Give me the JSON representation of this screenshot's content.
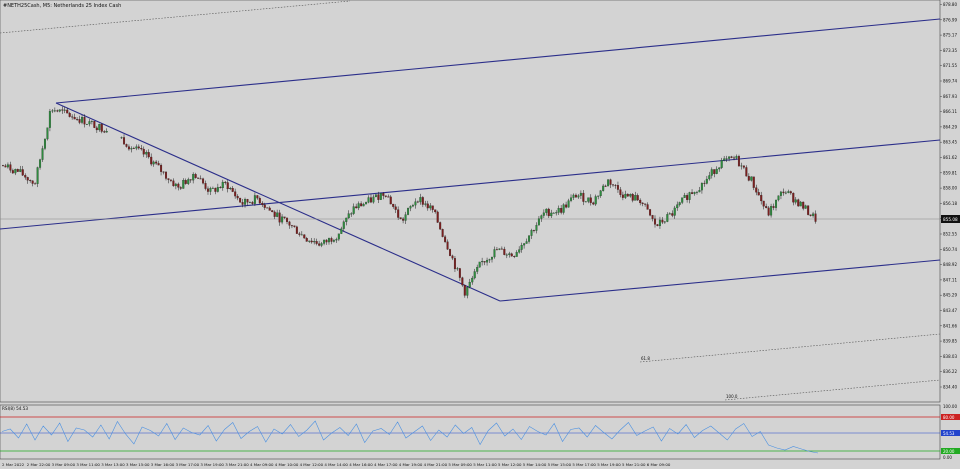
{
  "main_chart": {
    "symbol_label": "#NETH25Cash, M5: Netherlands 25 Index Cash",
    "price_axis": [
      "878.80",
      "876.99",
      "875.17",
      "873.35",
      "871.55",
      "869.74",
      "867.93",
      "866.11",
      "864.29",
      "863.45",
      "861.62",
      "859.81",
      "858.00",
      "856.18",
      "854.37",
      "852.55",
      "850.74",
      "848.92",
      "847.11",
      "845.29",
      "843.47",
      "841.66",
      "839.85",
      "838.03",
      "836.22",
      "834.40"
    ],
    "current_price": "855.08",
    "fib_labels": [
      "61.8",
      "100.0"
    ],
    "colors": {
      "background": "#d3d3d3",
      "channel": "#2b2e8a",
      "bull": "#2e8b3e",
      "bear": "#7a1f1f",
      "dotted": "#555555"
    }
  },
  "chart_data": [
    {
      "type": "candlestick",
      "title": "#NETH25Cash, M5: Netherlands 25 Index Cash",
      "timeframe": "M5",
      "ylim": [
        834.4,
        878.8
      ],
      "x_ticks": [
        "2 Mar 2022",
        "2 Mar 22:00",
        "3 Mar 09:00",
        "3 Mar 11:00",
        "3 Mar 13:00",
        "3 Mar 15:00",
        "3 Mar 16:00",
        "3 Mar 17:00",
        "3 Mar 19:00",
        "3 Mar 21:00",
        "4 Mar 09:00",
        "4 Mar 10:00",
        "4 Mar 12:00",
        "4 Mar 14:00",
        "4 Mar 16:00",
        "4 Mar 17:00",
        "4 Mar 19:00",
        "4 Mar 21:00",
        "5 Mar 09:00",
        "5 Mar 11:00",
        "5 Mar 12:00",
        "5 Mar 14:00",
        "5 Mar 15:00",
        "5 Mar 17:00",
        "5 Mar 19:00",
        "5 Mar 21:00",
        "6 Mar 09:00"
      ],
      "approx_close_path": [
        860.5,
        859.8,
        858.5,
        866.8,
        866.2,
        865.5,
        864.8,
        864.2,
        862.6,
        861.6,
        859.8,
        858.0,
        859.7,
        857.6,
        858.5,
        856.3,
        856.9,
        855.1,
        854.0,
        852.5,
        851.8,
        852.9,
        855.8,
        856.6,
        857.6,
        854.3,
        857.0,
        855.5,
        851.2,
        846.5,
        849.7,
        851.2,
        850.6,
        852.8,
        855.3,
        855.6,
        857.3,
        856.5,
        858.9,
        857.2,
        856.7,
        853.8,
        855.2,
        857.3,
        858.6,
        860.8,
        861.3,
        858.8,
        855.1,
        857.8,
        856.3,
        854.6
      ],
      "current_price": 855.08,
      "fibonacci_levels": [
        "61.8",
        "100.0"
      ]
    },
    {
      "type": "line",
      "title": "RSI(8) 54.53",
      "indicator": "RSI",
      "period": 8,
      "value": 54.53,
      "ylim": [
        0,
        100
      ],
      "levels": [
        20,
        80
      ],
      "values": [
        55,
        60,
        42,
        70,
        38,
        66,
        48,
        72,
        35,
        62,
        58,
        44,
        68,
        40,
        75,
        50,
        30,
        64,
        57,
        46,
        71,
        39,
        62,
        53,
        48,
        67,
        36,
        59,
        73,
        41,
        55,
        65,
        34,
        60,
        50,
        69,
        45,
        58,
        76,
        38,
        52,
        63,
        47,
        70,
        33,
        56,
        61,
        49,
        74,
        42,
        54,
        66,
        37,
        58,
        44,
        68,
        51,
        63,
        29,
        57,
        72,
        46,
        60,
        39,
        65,
        55,
        48,
        71,
        35,
        59,
        62,
        44,
        67,
        53,
        40,
        58,
        73,
        47,
        56,
        64,
        36,
        61,
        50,
        69,
        43,
        57,
        66,
        52,
        38,
        60,
        71,
        45,
        55,
        28,
        22,
        18,
        25,
        20,
        15,
        12
      ]
    }
  ],
  "rsi_panel": {
    "label": "RSI(8) 54.53",
    "axis": [
      "100.00",
      "80.00",
      "20.00",
      "0.00"
    ],
    "value_badge": "54.53",
    "colors": {
      "line": "#4a90e2",
      "upper_level": "#cc2222",
      "lower_level": "#22aa22",
      "badge": "#2244cc"
    }
  },
  "time_axis": [
    "2 Mar 2022",
    "2 Mar 22:00",
    "3 Mar 09:00",
    "3 Mar 11:00",
    "3 Mar 13:00",
    "3 Mar 15:00",
    "3 Mar 16:00",
    "3 Mar 17:00",
    "3 Mar 19:00",
    "3 Mar 21:00",
    "4 Mar 09:00",
    "4 Mar 10:00",
    "4 Mar 12:00",
    "4 Mar 14:00",
    "4 Mar 16:00",
    "4 Mar 17:00",
    "4 Mar 19:00",
    "4 Mar 21:00",
    "5 Mar 09:00",
    "5 Mar 11:00",
    "5 Mar 12:00",
    "5 Mar 14:00",
    "5 Mar 15:00",
    "5 Mar 17:00",
    "5 Mar 19:00",
    "5 Mar 21:00",
    "6 Mar 09:00"
  ]
}
